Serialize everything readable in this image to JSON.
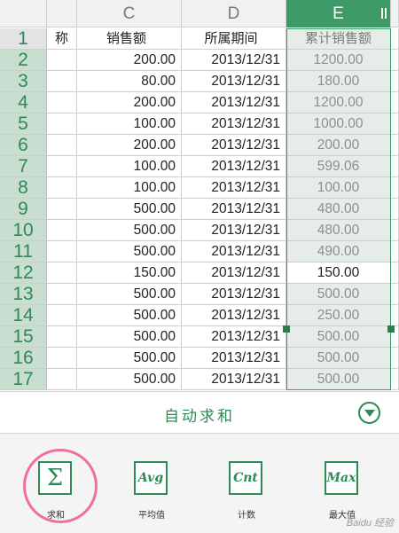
{
  "columns": [
    {
      "letter": "",
      "header": ""
    },
    {
      "letter": "",
      "header": "称"
    },
    {
      "letter": "C",
      "header": "销售额"
    },
    {
      "letter": "D",
      "header": "所属期间"
    },
    {
      "letter": "E",
      "header": "累计销售额"
    }
  ],
  "rows": [
    {
      "n": "1",
      "b": "称",
      "c": "销售额",
      "d": "所属期间",
      "e": "累计销售额"
    },
    {
      "n": "2",
      "c": "200.00",
      "d": "2013/12/31",
      "e": "1200.00"
    },
    {
      "n": "3",
      "c": "80.00",
      "d": "2013/12/31",
      "e": "180.00"
    },
    {
      "n": "4",
      "c": "200.00",
      "d": "2013/12/31",
      "e": "1200.00"
    },
    {
      "n": "5",
      "c": "100.00",
      "d": "2013/12/31",
      "e": "1000.00"
    },
    {
      "n": "6",
      "c": "200.00",
      "d": "2013/12/31",
      "e": "200.00"
    },
    {
      "n": "7",
      "c": "100.00",
      "d": "2013/12/31",
      "e": "599.06"
    },
    {
      "n": "8",
      "c": "100.00",
      "d": "2013/12/31",
      "e": "100.00"
    },
    {
      "n": "9",
      "c": "500.00",
      "d": "2013/12/31",
      "e": "480.00"
    },
    {
      "n": "10",
      "c": "500.00",
      "d": "2013/12/31",
      "e": "480.00"
    },
    {
      "n": "11",
      "c": "500.00",
      "d": "2013/12/31",
      "e": "490.00"
    },
    {
      "n": "12",
      "c": "150.00",
      "d": "2013/12/31",
      "e": "150.00"
    },
    {
      "n": "13",
      "c": "500.00",
      "d": "2013/12/31",
      "e": "500.00"
    },
    {
      "n": "14",
      "c": "500.00",
      "d": "2013/12/31",
      "e": "250.00"
    },
    {
      "n": "15",
      "c": "500.00",
      "d": "2013/12/31",
      "e": "500.00"
    },
    {
      "n": "16",
      "c": "500.00",
      "d": "2013/12/31",
      "e": "500.00"
    },
    {
      "n": "17",
      "c": "500.00",
      "d": "2013/12/31",
      "e": "500.00"
    }
  ],
  "active_row": "12",
  "autosum": {
    "label": "自动求和"
  },
  "functions": [
    {
      "icon_text": "Σ",
      "label": "求和",
      "icon": "sigma-icon"
    },
    {
      "icon_text": "Avg",
      "label": "平均值",
      "icon": "avg-icon"
    },
    {
      "icon_text": "Cnt",
      "label": "计数",
      "icon": "cnt-icon"
    },
    {
      "icon_text": "Max",
      "label": "最大值",
      "icon": "max-icon"
    }
  ],
  "watermark": "Baidu 经验",
  "colors": {
    "accent": "#2e8a57",
    "highlight_circle": "#f06fa0"
  }
}
